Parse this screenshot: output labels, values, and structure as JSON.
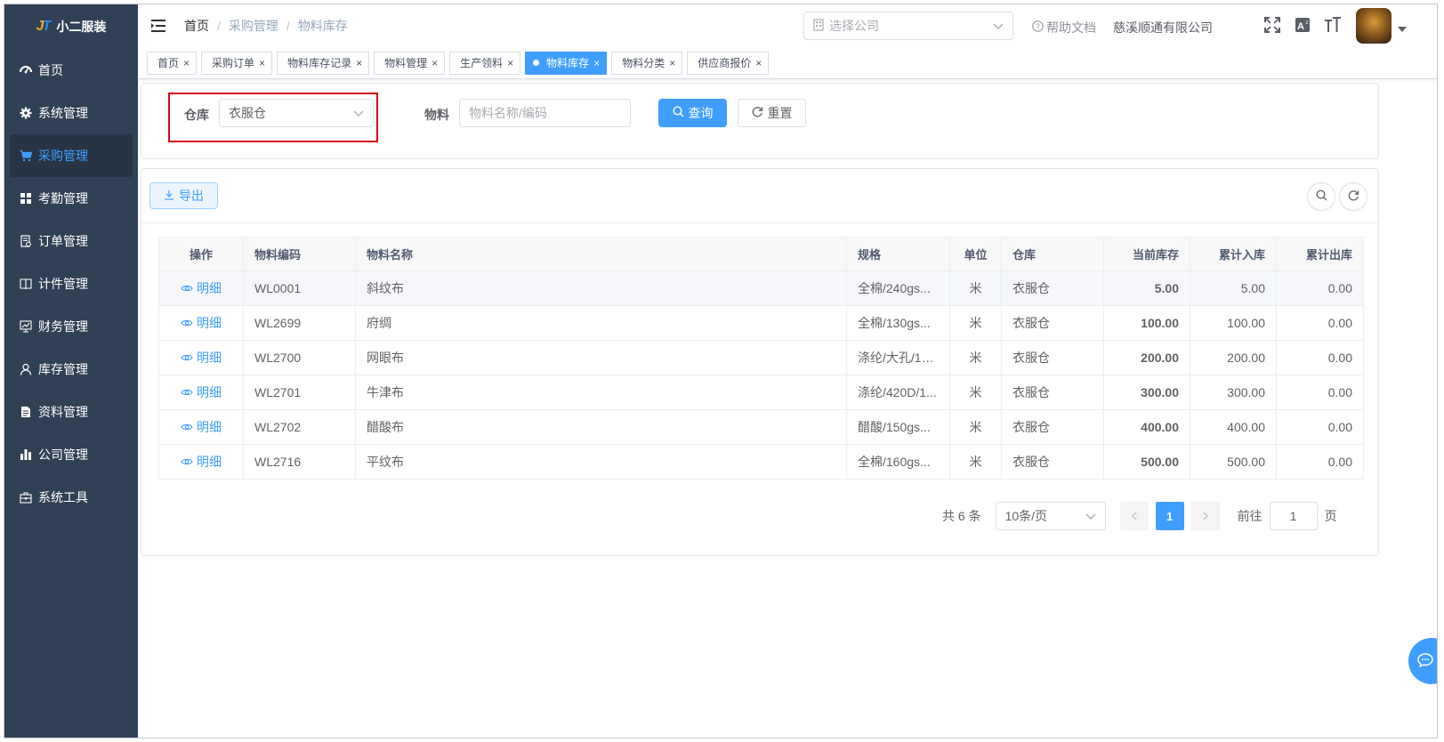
{
  "app": {
    "logo_mark": "JT",
    "title": "小二服装"
  },
  "sidebar": {
    "items": [
      {
        "label": "首页",
        "icon": "dashboard-icon",
        "active": false
      },
      {
        "label": "系统管理",
        "icon": "gear-icon",
        "active": false
      },
      {
        "label": "采购管理",
        "icon": "shopping-cart-icon",
        "active": true
      },
      {
        "label": "考勤管理",
        "icon": "grid-icon",
        "active": false
      },
      {
        "label": "订单管理",
        "icon": "order-doc-icon",
        "active": false
      },
      {
        "label": "计件管理",
        "icon": "book-icon",
        "active": false
      },
      {
        "label": "财务管理",
        "icon": "chart-monitor-icon",
        "active": false
      },
      {
        "label": "库存管理",
        "icon": "user-icon",
        "active": false
      },
      {
        "label": "资料管理",
        "icon": "file-icon",
        "active": false
      },
      {
        "label": "公司管理",
        "icon": "bar-chart-icon",
        "active": false
      },
      {
        "label": "系统工具",
        "icon": "toolbox-icon",
        "active": false
      }
    ]
  },
  "navbar": {
    "breadcrumb": [
      "首页",
      "采购管理",
      "物料库存"
    ],
    "company_placeholder": "选择公司",
    "help_label": "帮助文档",
    "company_name": "慈溪顺通有限公司"
  },
  "tags": [
    {
      "label": "首页",
      "active": false
    },
    {
      "label": "采购订单",
      "active": false
    },
    {
      "label": "物料库存记录",
      "active": false
    },
    {
      "label": "物料管理",
      "active": false
    },
    {
      "label": "生产领料",
      "active": false
    },
    {
      "label": "物料库存",
      "active": true
    },
    {
      "label": "物料分类",
      "active": false
    },
    {
      "label": "供应商报价",
      "active": false
    }
  ],
  "search": {
    "warehouse_label": "仓库",
    "warehouse_value": "衣服仓",
    "material_label": "物料",
    "material_placeholder": "物料名称/编码",
    "query_label": "查询",
    "reset_label": "重置"
  },
  "toolbar": {
    "export_label": "导出"
  },
  "table": {
    "columns": [
      "操作",
      "物料编码",
      "物料名称",
      "规格",
      "单位",
      "仓库",
      "当前库存",
      "累计入库",
      "累计出库"
    ],
    "action_label": "明细",
    "rows": [
      {
        "code": "WL0001",
        "name": "斜纹布",
        "spec": "全棉/240gs...",
        "unit": "米",
        "warehouse": "衣服仓",
        "current": "5.00",
        "in_total": "5.00",
        "out_total": "0.00"
      },
      {
        "code": "WL2699",
        "name": "府绸",
        "spec": "全棉/130gs...",
        "unit": "米",
        "warehouse": "衣服仓",
        "current": "100.00",
        "in_total": "100.00",
        "out_total": "0.00"
      },
      {
        "code": "WL2700",
        "name": "网眼布",
        "spec": "涤纶/大孔/15...",
        "unit": "米",
        "warehouse": "衣服仓",
        "current": "200.00",
        "in_total": "200.00",
        "out_total": "0.00"
      },
      {
        "code": "WL2701",
        "name": "牛津布",
        "spec": "涤纶/420D/1...",
        "unit": "米",
        "warehouse": "衣服仓",
        "current": "300.00",
        "in_total": "300.00",
        "out_total": "0.00"
      },
      {
        "code": "WL2702",
        "name": "醋酸布",
        "spec": "醋酸/150gs...",
        "unit": "米",
        "warehouse": "衣服仓",
        "current": "400.00",
        "in_total": "400.00",
        "out_total": "0.00"
      },
      {
        "code": "WL2716",
        "name": "平纹布",
        "spec": "全棉/160gs...",
        "unit": "米",
        "warehouse": "衣服仓",
        "current": "500.00",
        "in_total": "500.00",
        "out_total": "0.00"
      }
    ]
  },
  "pagination": {
    "total_text": "共 6 条",
    "page_size": "10条/页",
    "current_page": "1",
    "goto_prefix": "前往",
    "goto_value": "1",
    "goto_suffix": "页"
  },
  "colors": {
    "primary": "#409eff",
    "sidebar_bg": "#304156",
    "stock_green": "#67c23a",
    "highlight_red": "#d9001b"
  }
}
